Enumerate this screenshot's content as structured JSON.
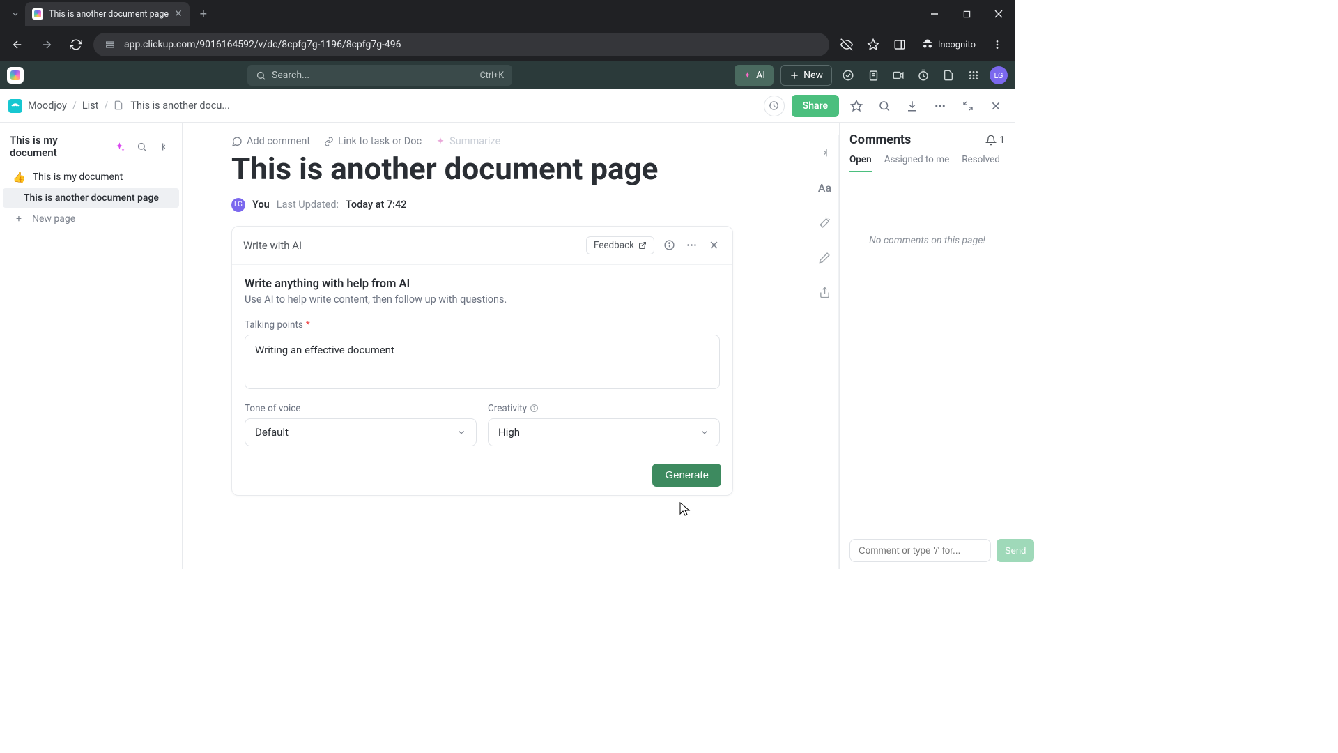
{
  "browser": {
    "tab_title": "This is another document page",
    "url": "app.clickup.com/9016164592/v/dc/8cpfg7g-1196/8cpfg7g-496",
    "incognito_label": "Incognito"
  },
  "app_top": {
    "search_placeholder": "Search...",
    "search_shortcut": "Ctrl+K",
    "ai_label": "AI",
    "new_label": "New",
    "avatar_initials": "LG"
  },
  "breadcrumb": {
    "workspace": "Moodjoy",
    "list": "List",
    "doc": "This is another docu...",
    "share_label": "Share"
  },
  "sidebar": {
    "title": "This is my document",
    "items": [
      {
        "emoji": "👍",
        "label": "This is my document"
      },
      {
        "emoji": "",
        "label": "This is another document page"
      }
    ],
    "new_page_label": "New page"
  },
  "toolbar": {
    "add_comment": "Add comment",
    "link_task": "Link to task or Doc",
    "summarize": "Summarize"
  },
  "document": {
    "title": "This is another document page",
    "author_initials": "LG",
    "author_label": "You",
    "updated_label": "Last Updated:",
    "updated_value": "Today at 7:42"
  },
  "ai_panel": {
    "header": "Write with AI",
    "feedback_label": "Feedback",
    "heading": "Write anything with help from AI",
    "subheading": "Use AI to help write content, then follow up with questions.",
    "talking_points_label": "Talking points",
    "talking_points_value": "Writing an effective document",
    "tone_label": "Tone of voice",
    "tone_value": "Default",
    "creativity_label": "Creativity",
    "creativity_value": "High",
    "generate_label": "Generate"
  },
  "comments": {
    "title": "Comments",
    "count": "1",
    "tabs": {
      "open": "Open",
      "assigned": "Assigned to me",
      "resolved": "Resolved"
    },
    "empty": "No comments on this page!",
    "input_placeholder": "Comment or type '/' for...",
    "send_label": "Send"
  }
}
